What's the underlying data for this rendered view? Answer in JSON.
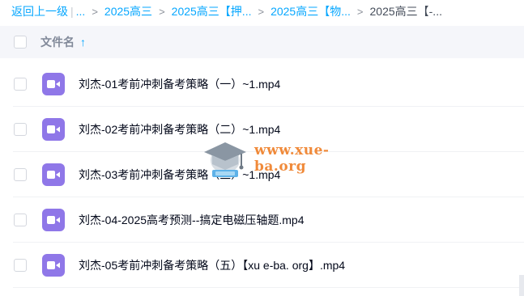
{
  "breadcrumb": {
    "back": "返回上一级",
    "separator": "|",
    "ellipsis": "...",
    "arrow": ">",
    "items": [
      "2025高三",
      "2025高三【押...",
      "2025高三【物..."
    ],
    "current": "2025高三【-..."
  },
  "header": {
    "column_title": "文件名",
    "sort_icon": "↑"
  },
  "files": [
    {
      "name": "刘杰-01考前冲刺备考策略（一）~1.mp4",
      "icon": "video-icon"
    },
    {
      "name": "刘杰-02考前冲刺备考策略（二）~1.mp4",
      "icon": "video-icon"
    },
    {
      "name": "刘杰-03考前冲刺备考策略（三）~1.mp4",
      "icon": "video-icon"
    },
    {
      "name": "刘杰-04-2025高考预测--搞定电磁压轴题.mp4",
      "icon": "video-icon"
    },
    {
      "name": "刘杰-05考前冲刺备考策略（五）【xu e-ba. org】.mp4",
      "icon": "video-icon"
    }
  ],
  "watermark": {
    "text": "www.xue-ba.org"
  },
  "colors": {
    "accent": "#06a7ff",
    "video_icon": "#8f77e8",
    "watermark": "#f08a3a"
  }
}
